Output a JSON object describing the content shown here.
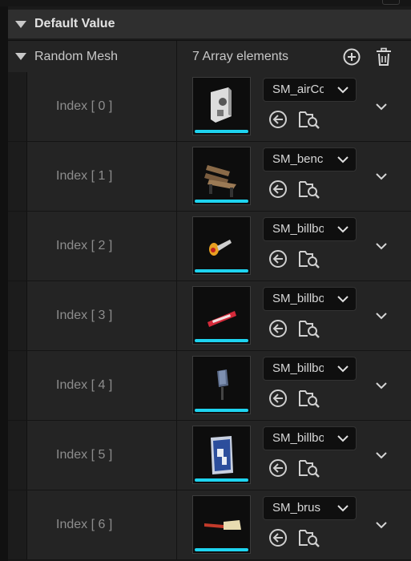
{
  "section": {
    "title": "Default Value"
  },
  "array": {
    "name": "Random Mesh",
    "count_label": "7 Array elements"
  },
  "elements": [
    {
      "index_label": "Index [ 0 ]",
      "asset": "SM_airCo"
    },
    {
      "index_label": "Index [ 1 ]",
      "asset": "SM_benc"
    },
    {
      "index_label": "Index [ 2 ]",
      "asset": "SM_billbo"
    },
    {
      "index_label": "Index [ 3 ]",
      "asset": "SM_billbo"
    },
    {
      "index_label": "Index [ 4 ]",
      "asset": "SM_billbo"
    },
    {
      "index_label": "Index [ 5 ]",
      "asset": "SM_billbo"
    },
    {
      "index_label": "Index [ 6 ]",
      "asset": "SM_brus"
    }
  ],
  "icons": {
    "section_toggle": "caret-down-icon",
    "add": "plus-circle-icon",
    "clear": "trash-icon",
    "use_selected": "arrow-left-circle-icon",
    "browse": "folder-search-icon",
    "combo": "chevron-down-icon",
    "expand": "chevron-down-icon"
  },
  "colors": {
    "asset_bar": "#1ed4f0",
    "background": "#1a1a1a",
    "row": "#242424",
    "header": "#2f2f2f"
  }
}
